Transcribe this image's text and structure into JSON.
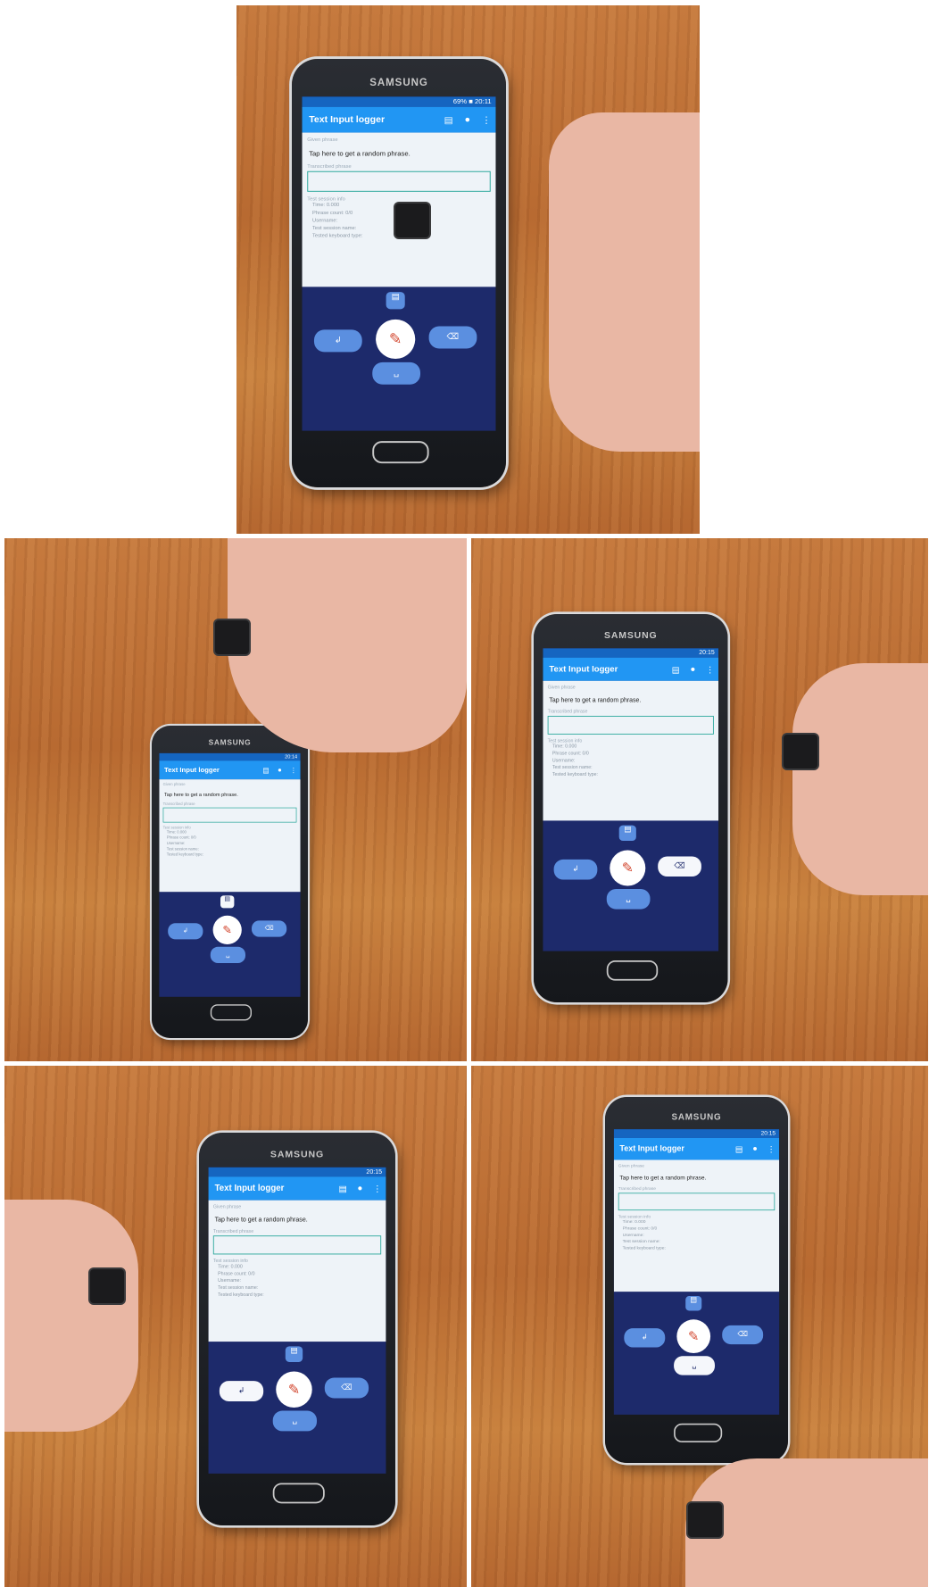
{
  "phone": {
    "brand": "SAMSUNG",
    "status_text": "69% ■ 20:11",
    "app_title": "Text Input logger",
    "given_label": "Given phrase",
    "given_phrase": "Tap here to get a random phrase.",
    "transcribed_label": "Transcribed phrase",
    "session_label": "Test session info",
    "session_lines": [
      "Time: 0.000",
      "Phrase count: 0/0",
      "Username:",
      "Test session name:",
      "Tested keyboard type:"
    ],
    "keys": {
      "doc": "▤",
      "pen": "✎",
      "enter": "↲",
      "back": "⌫",
      "space": "␣"
    }
  },
  "panels": [
    {
      "status_time": "20:11",
      "highlight": "none"
    },
    {
      "status_time": "20:14",
      "highlight": "doc"
    },
    {
      "status_time": "20:15",
      "highlight": "back"
    },
    {
      "status_time": "20:15",
      "highlight": "enter"
    },
    {
      "status_time": "20:15",
      "highlight": "space"
    }
  ]
}
